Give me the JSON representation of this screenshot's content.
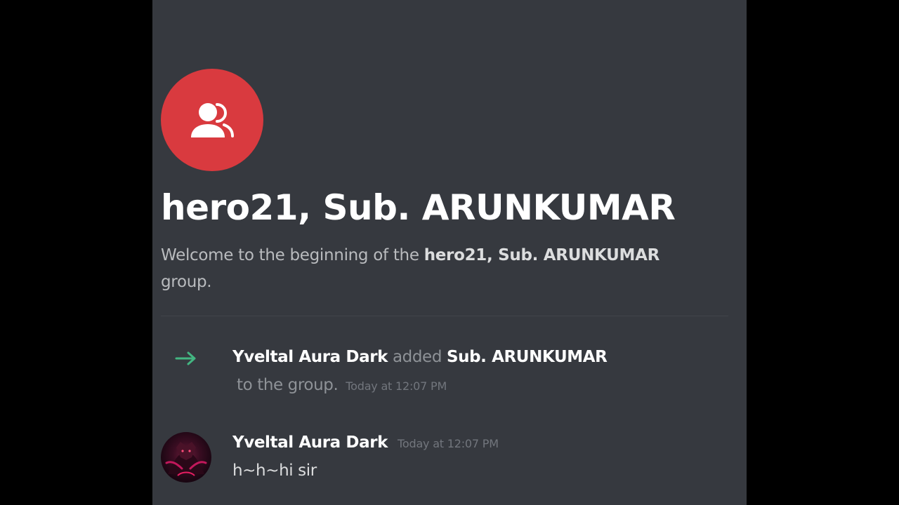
{
  "group": {
    "title": "hero21, Sub. ARUNKUMAR",
    "avatar_icon": "group-people-icon",
    "avatar_color": "#d93a3f",
    "welcome_prefix": "Welcome to the beginning of the ",
    "welcome_name": "hero21, Sub. ARUNKUMAR",
    "welcome_suffix": " group."
  },
  "system_message": {
    "icon": "arrow-right-icon",
    "icon_color": "#43b581",
    "actor": "Yveltal Aura Dark",
    "action": "added",
    "target": "Sub. ARUNKUMAR",
    "suffix": "to the group.",
    "timestamp": "Today at 12:07 PM"
  },
  "message": {
    "author": "Yveltal Aura Dark",
    "timestamp": "Today at 12:07 PM",
    "content": "h~h~hi sir",
    "avatar": "user-avatar"
  },
  "theme": {
    "background": "#36393f",
    "letterbox": "#000000"
  }
}
